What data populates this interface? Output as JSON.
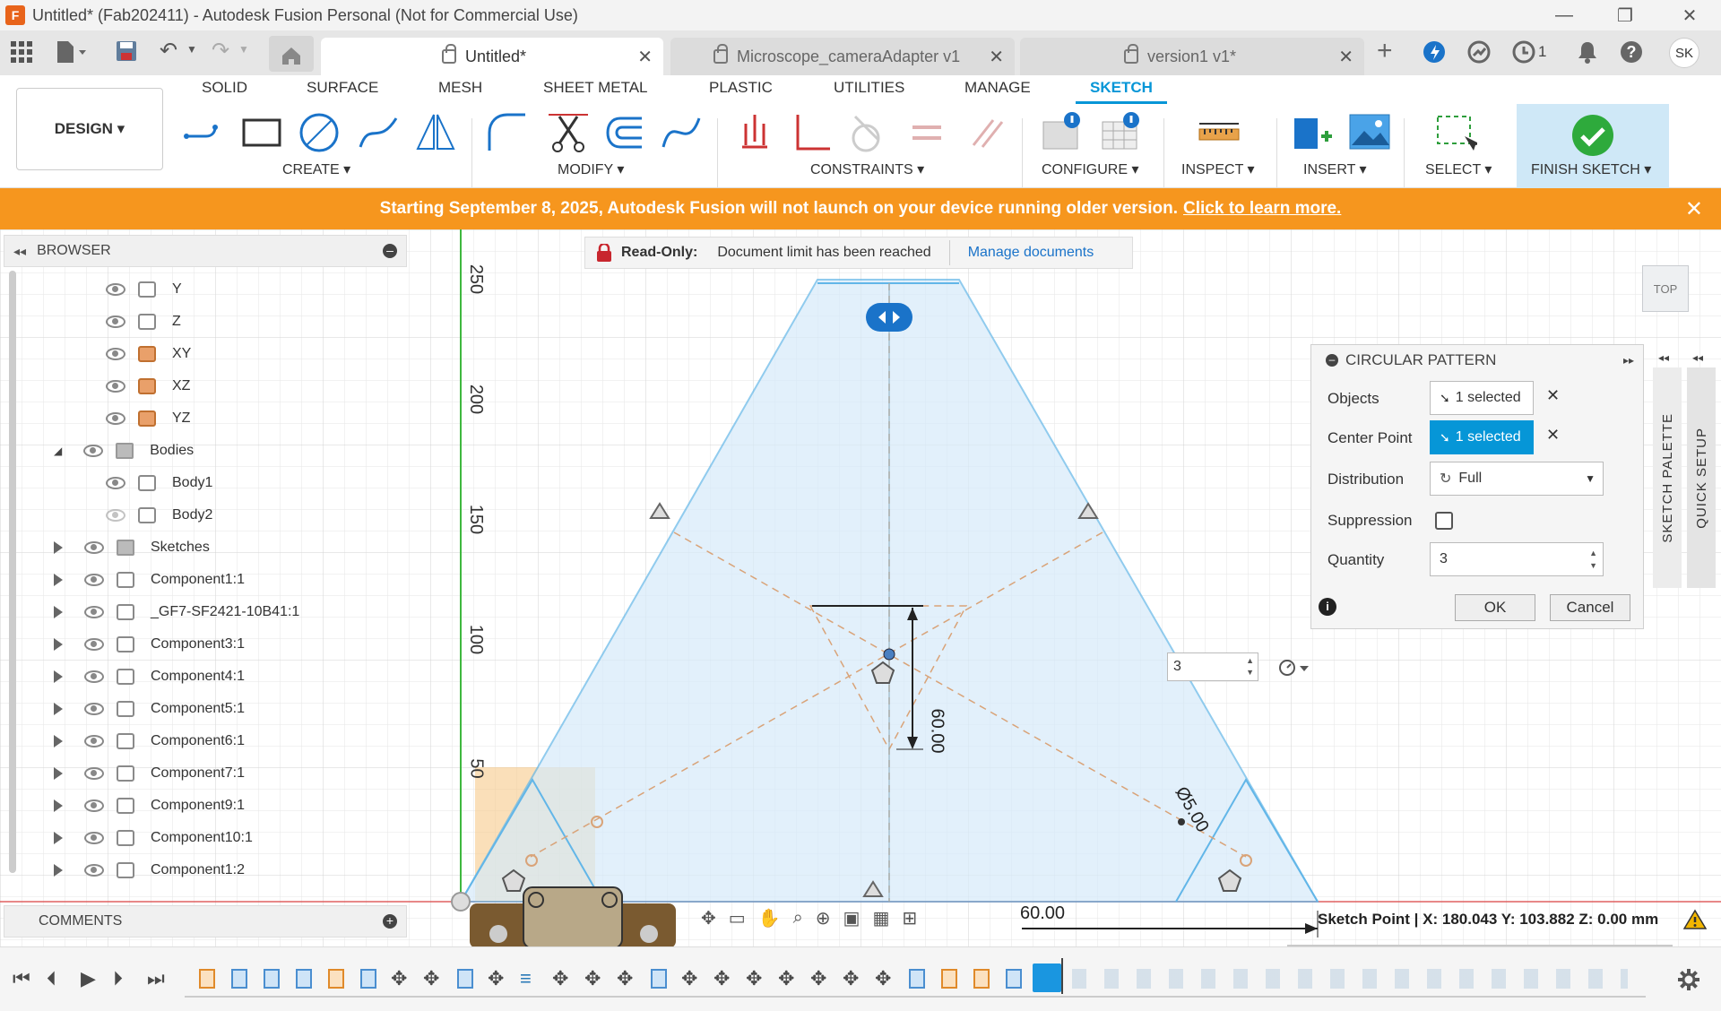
{
  "window": {
    "title": "Untitled* (Fab202411) - Autodesk Fusion Personal (Not for Commercial Use)",
    "app_icon": "F",
    "minimize": "—",
    "restore": "❐",
    "close": "✕"
  },
  "tabs": [
    {
      "label": "Untitled*",
      "active": true
    },
    {
      "label": "Microscope_cameraAdapter v1",
      "active": false
    },
    {
      "label": "version1 v1*",
      "active": false
    }
  ],
  "top_right": {
    "job_count": "1",
    "user": "SK"
  },
  "ribbon": {
    "tabs": [
      "SOLID",
      "SURFACE",
      "MESH",
      "SHEET METAL",
      "PLASTIC",
      "UTILITIES",
      "MANAGE",
      "SKETCH"
    ],
    "workspace": "DESIGN ▾",
    "groups": {
      "create": "CREATE ▾",
      "modify": "MODIFY ▾",
      "constraints": "CONSTRAINTS ▾",
      "configure": "CONFIGURE ▾",
      "inspect": "INSPECT ▾",
      "insert": "INSERT ▾",
      "select": "SELECT ▾",
      "finish": "FINISH SKETCH ▾"
    }
  },
  "banner": {
    "text": "Starting September 8, 2025, Autodesk Fusion will not launch on your device running older version.",
    "link": "Click to learn more.",
    "close": "✕"
  },
  "browser": {
    "title": "BROWSER",
    "items": [
      {
        "label": "Y",
        "indent": 1,
        "icon": "axis"
      },
      {
        "label": "Z",
        "indent": 1,
        "icon": "axis"
      },
      {
        "label": "XY",
        "indent": 1,
        "icon": "plane"
      },
      {
        "label": "XZ",
        "indent": 1,
        "icon": "plane"
      },
      {
        "label": "YZ",
        "indent": 1,
        "icon": "plane"
      },
      {
        "label": "Bodies",
        "indent": 0,
        "icon": "folder"
      },
      {
        "label": "Body1",
        "indent": 1,
        "icon": "body"
      },
      {
        "label": "Body2",
        "indent": 1,
        "icon": "body"
      },
      {
        "label": "Sketches",
        "indent": 0,
        "icon": "folder"
      },
      {
        "label": "Component1:1",
        "indent": 0,
        "icon": "component"
      },
      {
        "label": "_GF7-SF2421-10B41:1",
        "indent": 0,
        "icon": "component"
      },
      {
        "label": "Component3:1",
        "indent": 0,
        "icon": "component"
      },
      {
        "label": "Component4:1",
        "indent": 0,
        "icon": "component"
      },
      {
        "label": "Component5:1",
        "indent": 0,
        "icon": "component"
      },
      {
        "label": "Component6:1",
        "indent": 0,
        "icon": "component"
      },
      {
        "label": "Component7:1",
        "indent": 0,
        "icon": "component"
      },
      {
        "label": "Component9:1",
        "indent": 0,
        "icon": "component"
      },
      {
        "label": "Component10:1",
        "indent": 0,
        "icon": "component"
      },
      {
        "label": "Component1:2",
        "indent": 0,
        "icon": "component"
      }
    ]
  },
  "comments": {
    "title": "COMMENTS"
  },
  "readonly": {
    "label": "Read-Only:",
    "message": "Document limit has been reached",
    "link": "Manage documents"
  },
  "viewport": {
    "ruler": [
      "250",
      "200",
      "150",
      "100",
      "50"
    ],
    "dim_vertical": "60.00",
    "dim_diameter": "Ø5.00",
    "dim_horizontal": "60.00",
    "quantity_inline": "3",
    "viewcube": "TOP"
  },
  "dialog": {
    "title": "CIRCULAR PATTERN",
    "objects_label": "Objects",
    "objects_value": "1 selected",
    "center_label": "Center Point",
    "center_value": "1 selected",
    "distribution_label": "Distribution",
    "distribution_value": "Full",
    "suppression_label": "Suppression",
    "quantity_label": "Quantity",
    "quantity_value": "3",
    "ok": "OK",
    "cancel": "Cancel"
  },
  "side_palettes": {
    "sketch_palette": "SKETCH PALETTE",
    "quick_setup": "QUICK SETUP"
  },
  "status": "Sketch Point | X: 180.043 Y: 103.882 Z: 0.00 mm"
}
